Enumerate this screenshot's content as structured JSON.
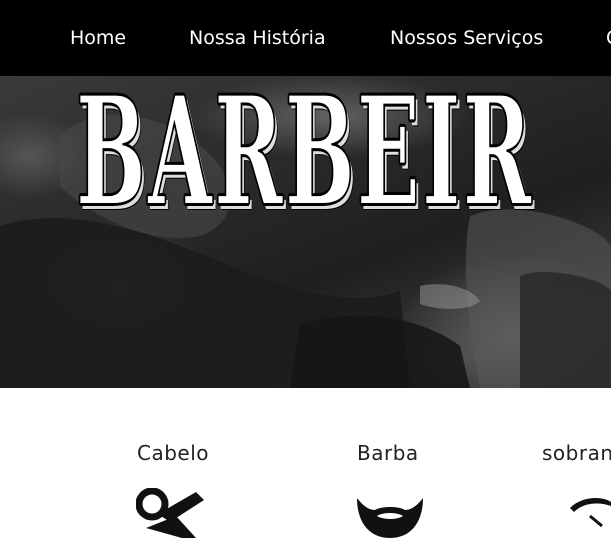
{
  "nav": {
    "items": [
      {
        "label": "Home"
      },
      {
        "label": "Nossa História"
      },
      {
        "label": "Nossos Serviços"
      },
      {
        "label": "C"
      }
    ]
  },
  "hero": {
    "title": "BARBEIR"
  },
  "services": {
    "items": [
      {
        "title": "Cabelo",
        "icon": "scissors-icon"
      },
      {
        "title": "Barba",
        "icon": "beard-icon"
      },
      {
        "title": "sobrancelha",
        "icon": "eyebrow-icon"
      }
    ]
  },
  "colors": {
    "nav_bg": "#000000",
    "nav_text": "#ffffff",
    "page_bg": "#ffffff",
    "text": "#222222"
  }
}
